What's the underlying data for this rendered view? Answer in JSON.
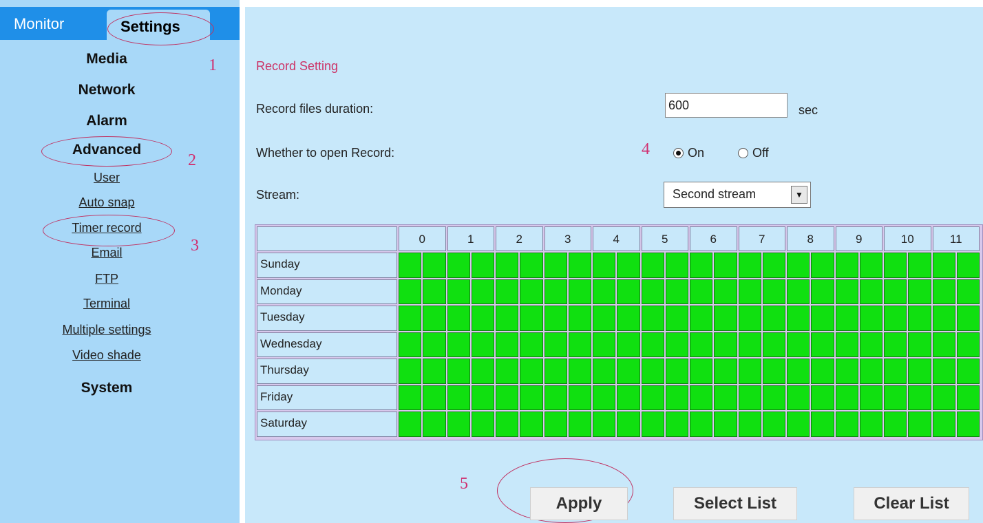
{
  "tabs": {
    "monitor": "Monitor",
    "settings": "Settings"
  },
  "sidebar": {
    "media": "Media",
    "network": "Network",
    "alarm": "Alarm",
    "advanced": "Advanced",
    "links": [
      "User",
      "Auto snap",
      "Timer record",
      "Email",
      "FTP",
      "Terminal",
      "Multiple settings",
      "Video shade"
    ],
    "system": "System"
  },
  "form": {
    "section_title": "Record Setting",
    "duration_label": "Record files duration:",
    "duration_value": "600",
    "duration_unit": "sec",
    "open_record_label": "Whether to open Record:",
    "radio_on": "On",
    "radio_off": "Off",
    "open_record_value": "On",
    "stream_label": "Stream:",
    "stream_value": "Second stream"
  },
  "schedule": {
    "hours": [
      "0",
      "1",
      "2",
      "3",
      "4",
      "5",
      "6",
      "7",
      "8",
      "9",
      "10",
      "11"
    ],
    "days": [
      "Sunday",
      "Monday",
      "Tuesday",
      "Wednesday",
      "Thursday",
      "Friday",
      "Saturday"
    ],
    "active_color": "#10e010"
  },
  "buttons": {
    "apply": "Apply",
    "select_list": "Select List",
    "clear_list": "Clear List"
  },
  "annotations": [
    "1",
    "2",
    "3",
    "4",
    "5"
  ],
  "colors": {
    "title": "#cc3366",
    "tab_bar": "#1f8fe8",
    "sidebar": "#a8d8f8",
    "panel": "#c8e8fa",
    "annotation": "#d03070"
  }
}
